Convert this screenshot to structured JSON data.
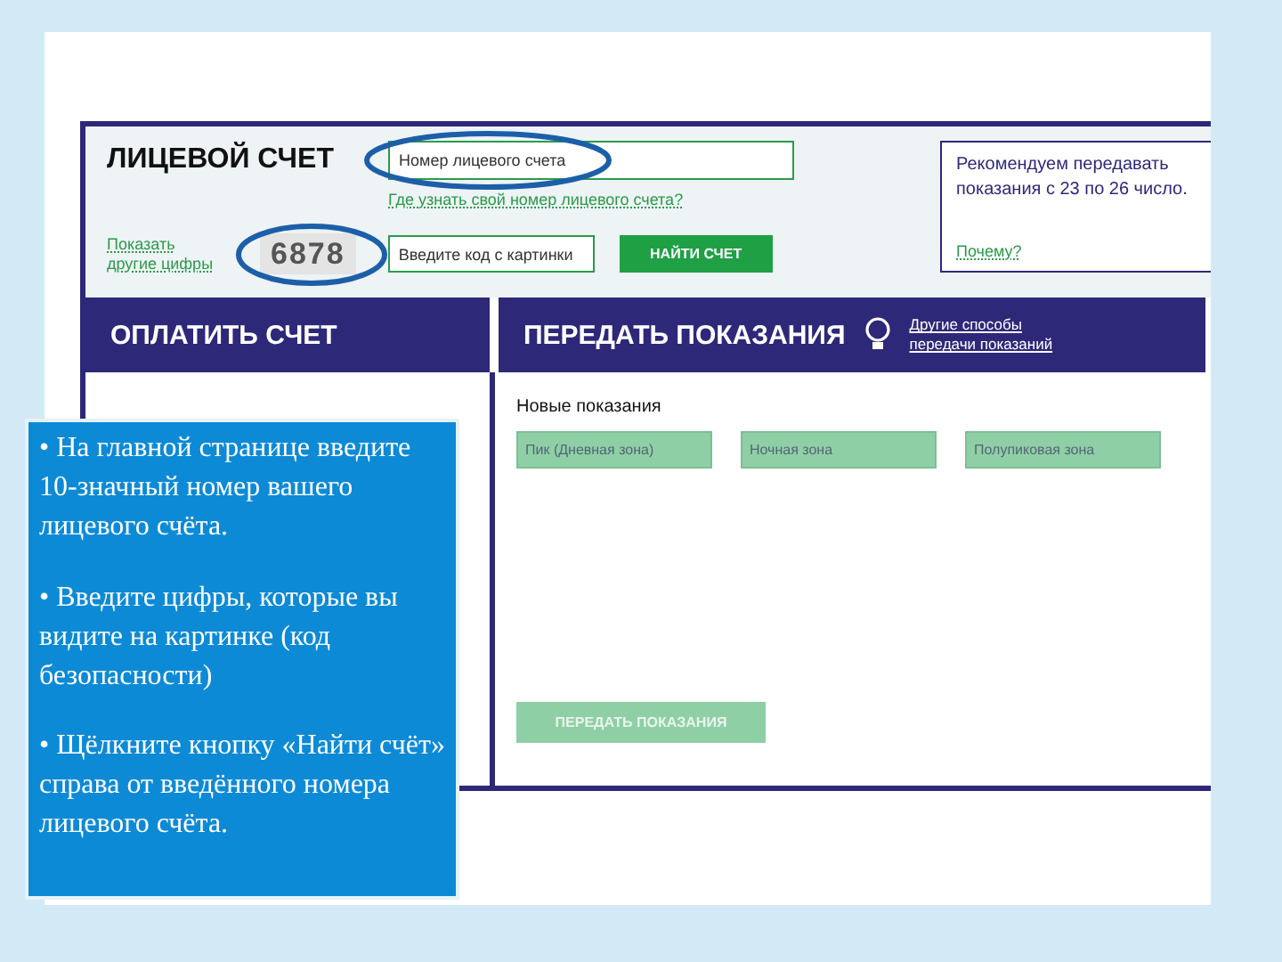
{
  "account": {
    "title": "ЛИЦЕВОЙ СЧЕТ",
    "number_field": {
      "placeholder": "Номер лицевого счета"
    },
    "help_link": "Где узнать свой номер лицевого счета?",
    "captcha_link": "Показать другие цифры",
    "captcha": "6878",
    "code_field": {
      "placeholder": "Введите код с картинки"
    },
    "find_button": "НАЙТИ СЧЕТ",
    "note": "Рекомендуем передавать показания с 23 по 26 число.",
    "note_link": "Почему?"
  },
  "pay": {
    "title": "ОПЛАТИТЬ СЧЕТ"
  },
  "readings": {
    "title": "ПЕРЕДАТЬ ПОКАЗАНИЯ",
    "other_link": "Другие способы передачи показаний",
    "subtitle": "Новые показания",
    "fields": [
      {
        "placeholder": "Пик (Дневная зона)"
      },
      {
        "placeholder": "Ночная зона"
      },
      {
        "placeholder": "Полупиковая зона"
      }
    ],
    "submit": {
      "label": "ПЕРЕДАТЬ ПОКАЗАНИЯ",
      "disabled": true
    }
  },
  "callout": {
    "items": [
      "• На главной странице введите 10-значный номер вашего лицевого счёта.",
      "• Введите цифры, которые вы видите на картинке (код безопасности)",
      "• Щёлкните кнопку «Найти счёт» справа от введённого номера лицевого счёта."
    ]
  }
}
